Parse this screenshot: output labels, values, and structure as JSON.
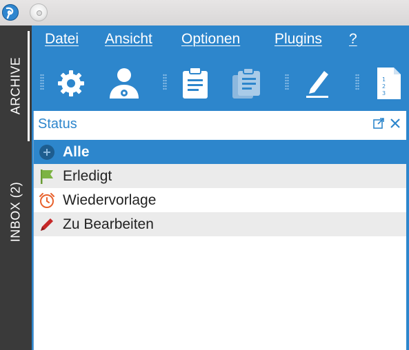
{
  "window": {
    "title": ""
  },
  "sidebar": {
    "tabs": [
      {
        "label": "ARCHIVE",
        "selected": true
      },
      {
        "label": "INBOX (2)",
        "selected": false
      }
    ]
  },
  "menubar": {
    "items": [
      "Datei",
      "Ansicht",
      "Optionen",
      "Plugins",
      "?"
    ]
  },
  "toolbar": {
    "buttons": [
      {
        "icon": "gear-icon",
        "enabled": true
      },
      {
        "icon": "user-settings-icon",
        "enabled": true
      },
      {
        "icon": "clipboard-icon",
        "enabled": true
      },
      {
        "icon": "clipboard-stack-icon",
        "enabled": false
      },
      {
        "icon": "pencil-icon",
        "enabled": true
      },
      {
        "icon": "numbered-document-icon",
        "enabled": true
      }
    ]
  },
  "status_panel": {
    "title": "Status",
    "items": [
      {
        "label": "Alle",
        "icon": "circle-icon",
        "selected": true
      },
      {
        "label": "Erledigt",
        "icon": "green-flag-icon",
        "selected": false
      },
      {
        "label": "Wiedervorlage",
        "icon": "alarm-clock-icon",
        "selected": false
      },
      {
        "label": "Zu Bearbeiten",
        "icon": "red-pencil-icon",
        "selected": false
      }
    ]
  },
  "colors": {
    "accent": "#2d86cc",
    "sidebar": "#3a3a3a",
    "flag": "#7cb342",
    "clock": "#e8612c",
    "pencil": "#c62828"
  }
}
